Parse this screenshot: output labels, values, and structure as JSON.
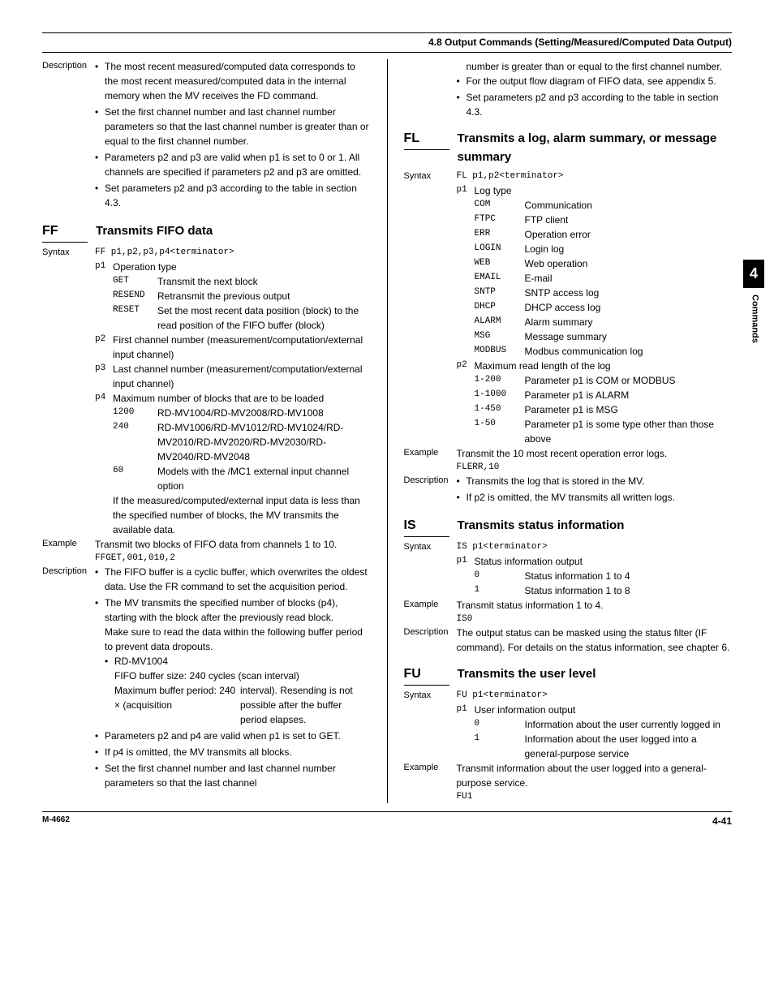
{
  "header": "4.8  Output Commands (Setting/Measured/Computed Data Output)",
  "tab": {
    "num": "4",
    "label": "Commands"
  },
  "footer": {
    "left": "M-4662",
    "right": "4-41"
  },
  "left": {
    "desc_top": {
      "label": "Description",
      "items": [
        "The most recent measured/computed data corresponds to the most recent measured/computed data in the internal memory when the MV receives the FD command.",
        "Set the first channel number and last channel number parameters so that the last channel number is greater than or equal to the first channel number.",
        "Parameters p2 and p3 are valid when p1 is set to 0 or 1. All channels are specified if parameters p2 and p3 are omitted.",
        "Set parameters p2 and p3 according to the table in section 4.3."
      ]
    },
    "ff": {
      "name": "FF",
      "title": "Transmits FIFO data",
      "syntax_label": "Syntax",
      "syntax": "FF p1,p2,p3,p4<terminator>",
      "p1": {
        "key": "p1",
        "label": "Operation type",
        "opts": [
          {
            "k": "GET",
            "v": "Transmit the next block"
          },
          {
            "k": "RESEND",
            "v": "Retransmit the previous output"
          },
          {
            "k": "RESET",
            "v": "Set the most recent data position (block) to the read position of the FIFO buffer (block)"
          }
        ]
      },
      "p2": {
        "key": "p2",
        "text": "First channel number (measurement/computation/external input channel)"
      },
      "p3": {
        "key": "p3",
        "text": "Last channel number (measurement/computation/external input channel)"
      },
      "p4": {
        "key": "p4",
        "label": "Maximum number of blocks that are to be loaded",
        "opts": [
          {
            "k": "1200",
            "v": "RD-MV1004/RD-MV2008/RD-MV1008"
          },
          {
            "k": "240",
            "v": "RD-MV1006/RD-MV1012/RD-MV1024/RD-MV2010/RD-MV2020/RD-MV2030/RD-MV2040/RD-MV2048"
          },
          {
            "k": "60",
            "v": "Models with the /MC1 external input channel option"
          }
        ],
        "note": "If the measured/computed/external input data is less than the specified number of blocks, the MV transmits the available data."
      },
      "example_label": "Example",
      "example_text": "Transmit two blocks of FIFO data from channels 1 to 10.",
      "example_code": "FFGET,001,010,2",
      "desc_label": "Description",
      "desc_items": [
        "The FIFO buffer is a cyclic buffer, which overwrites the oldest data. Use the FR command to set the acquisition period.",
        "The MV transmits the specified number of blocks (p4), starting with the block after the previously read block."
      ],
      "desc_note1": "Make sure to read the data within the following buffer period to prevent data dropouts.",
      "desc_sub_head": "RD-MV1004",
      "desc_sub_l1": "FIFO buffer size: 240 cycles (scan interval)",
      "desc_sub_l2a": "Maximum buffer period: 240 × (acquisition",
      "desc_sub_l2b": "interval). Resending is not possible after the buffer period elapses.",
      "desc_items2": [
        "Parameters p2 and p4 are valid when p1 is set to GET.",
        "If p4 is omitted, the MV transmits all blocks.",
        "Set the first channel number and last channel number parameters so that the last channel"
      ]
    }
  },
  "right": {
    "cont": {
      "line1": "number is greater than or equal to the first channel number.",
      "items": [
        "For the output flow diagram of FIFO data, see appendix 5.",
        "Set parameters p2 and p3 according to the table in section 4.3."
      ]
    },
    "fl": {
      "name": "FL",
      "title": "Transmits a log, alarm summary, or message summary",
      "syntax_label": "Syntax",
      "syntax": "FL p1,p2<terminator>",
      "p1": {
        "key": "p1",
        "label": "Log type",
        "opts": [
          {
            "k": "COM",
            "v": "Communication"
          },
          {
            "k": "FTPC",
            "v": "FTP client"
          },
          {
            "k": "ERR",
            "v": "Operation error"
          },
          {
            "k": "LOGIN",
            "v": "Login log"
          },
          {
            "k": "WEB",
            "v": "Web operation"
          },
          {
            "k": "EMAIL",
            "v": "E-mail"
          },
          {
            "k": "SNTP",
            "v": "SNTP access log"
          },
          {
            "k": "DHCP",
            "v": "DHCP access log"
          },
          {
            "k": "ALARM",
            "v": "Alarm summary"
          },
          {
            "k": "MSG",
            "v": "Message summary"
          },
          {
            "k": "MODBUS",
            "v": "Modbus communication log"
          }
        ]
      },
      "p2": {
        "key": "p2",
        "label": "Maximum read length of the log",
        "opts": [
          {
            "k": "1-200",
            "v": "Parameter p1 is COM or MODBUS"
          },
          {
            "k": "1-1000",
            "v": "Parameter p1 is ALARM"
          },
          {
            "k": "1-450",
            "v": "Parameter p1 is MSG"
          },
          {
            "k": "1-50",
            "v": "Parameter p1 is some type other than those above"
          }
        ]
      },
      "example_label": "Example",
      "example_text": "Transmit the 10 most recent operation error logs.",
      "example_code": "FLERR,10",
      "desc_label": "Description",
      "desc_items": [
        "Transmits the log that is stored in the MV.",
        "If p2 is omitted, the MV transmits all written logs."
      ]
    },
    "is": {
      "name": "IS",
      "title": "Transmits status information",
      "syntax_label": "Syntax",
      "syntax": "IS p1<terminator>",
      "p1": {
        "key": "p1",
        "label": "Status information output",
        "opts": [
          {
            "k": "0",
            "v": "Status information 1 to 4"
          },
          {
            "k": "1",
            "v": "Status information 1 to 8"
          }
        ]
      },
      "example_label": "Example",
      "example_text": "Transmit status information 1 to 4.",
      "example_code": "IS0",
      "desc_label": "Description",
      "desc_text": "The output status can be masked using the status filter (IF command). For details on the status information, see chapter 6."
    },
    "fu": {
      "name": "FU",
      "title": "Transmits the user level",
      "syntax_label": "Syntax",
      "syntax": "FU p1<terminator>",
      "p1": {
        "key": "p1",
        "label": "User information output",
        "opts": [
          {
            "k": "0",
            "v": "Information about the user currently logged in"
          },
          {
            "k": "1",
            "v": "Information about the user logged into a general-purpose service"
          }
        ]
      },
      "example_label": "Example",
      "example_text": "Transmit information about the user logged into a general-purpose service.",
      "example_code": "FU1"
    }
  }
}
